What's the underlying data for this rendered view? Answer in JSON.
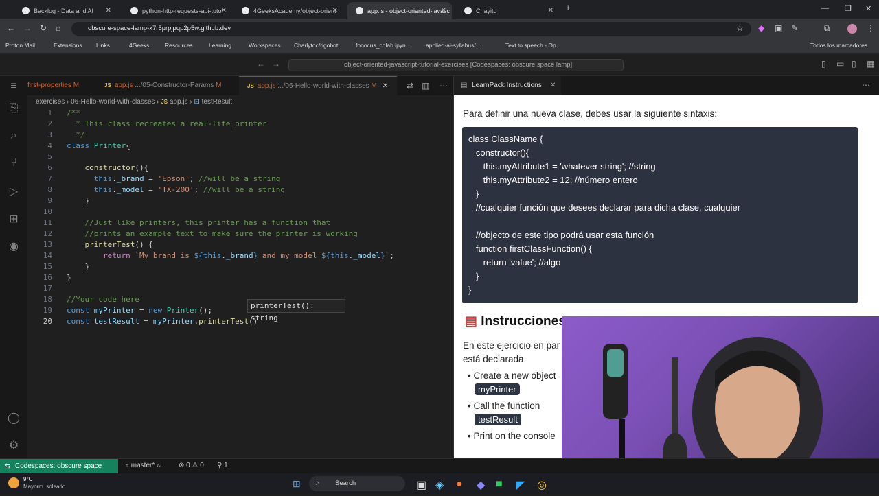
{
  "browser": {
    "tabs": [
      {
        "label": "Backlog - Data and AI"
      },
      {
        "label": "python-http-requests-api-tutor"
      },
      {
        "label": "4GeeksAcademy/object-orient"
      },
      {
        "label": "app.js - object-oriented-javasc"
      },
      {
        "label": "Chayito"
      }
    ],
    "url": "obscure-space-lamp-x7r5prpjpqp2p5w.github.dev",
    "bookmarks": [
      "Proton Mail",
      "Extensions",
      "Links",
      "4Geeks",
      "Resources",
      "Learning",
      "Workspaces",
      "Charlytoc/rigobot",
      "fooocus_colab.ipyn...",
      "applied-ai-syllabus/...",
      "Text to speech - Op...",
      "Todos los marcadores"
    ]
  },
  "vscode": {
    "command_center": "object-oriented-javascript-tutorial-exercises [Codespaces: obscure space lamp]",
    "editor_tabs": [
      {
        "name": "first-properties",
        "path": "",
        "mark": "M"
      },
      {
        "name": "app.js",
        "path": ".../05-Constructor-Params",
        "mark": "M"
      },
      {
        "name": "app.js",
        "path": ".../06-Hello-world-with-classes",
        "mark": "M"
      }
    ],
    "breadcrumb": {
      "folder": "exercises",
      "sub": "06-Hello-world-with-classes",
      "file": "app.js",
      "symbol": "testResult"
    },
    "tooltip": "printerTest(): string",
    "panel_tab": "LearnPack Instructions",
    "status": {
      "remote": "Codespaces: obscure space lamp",
      "branch": "master*",
      "problems": "⊗ 0 ⚠ 0",
      "ports": "1"
    }
  },
  "instructions": {
    "intro": "Para definir una nueva clase, debes usar la siguiente sintaxis:",
    "code_lines": [
      "class ClassName {",
      "   constructor(){",
      "      this.myAttribute1 = 'whatever string'; //string",
      "      this.myAttribute2 = 12; //número entero",
      "   }",
      "   //cualquier función que desees declarar para dicha clase, cualquier",
      "",
      "   //objecto de este tipo podrá usar esta función",
      "   function firstClassFunction() {",
      "      return 'value'; //algo",
      "   }",
      "}"
    ],
    "heading": "Instrucciones",
    "para1": "En este ejercicio en par",
    "para2": "está declarada.",
    "bullets": [
      {
        "text": "Create a new object",
        "pill": "myPrinter"
      },
      {
        "text": "Call the function",
        "pill": "testResult"
      },
      {
        "text": "Print on the console",
        "pill": ""
      }
    ]
  },
  "taskbar": {
    "weather_temp": "9°C",
    "weather_desc": "Mayorm. soleado",
    "search": "Search"
  }
}
